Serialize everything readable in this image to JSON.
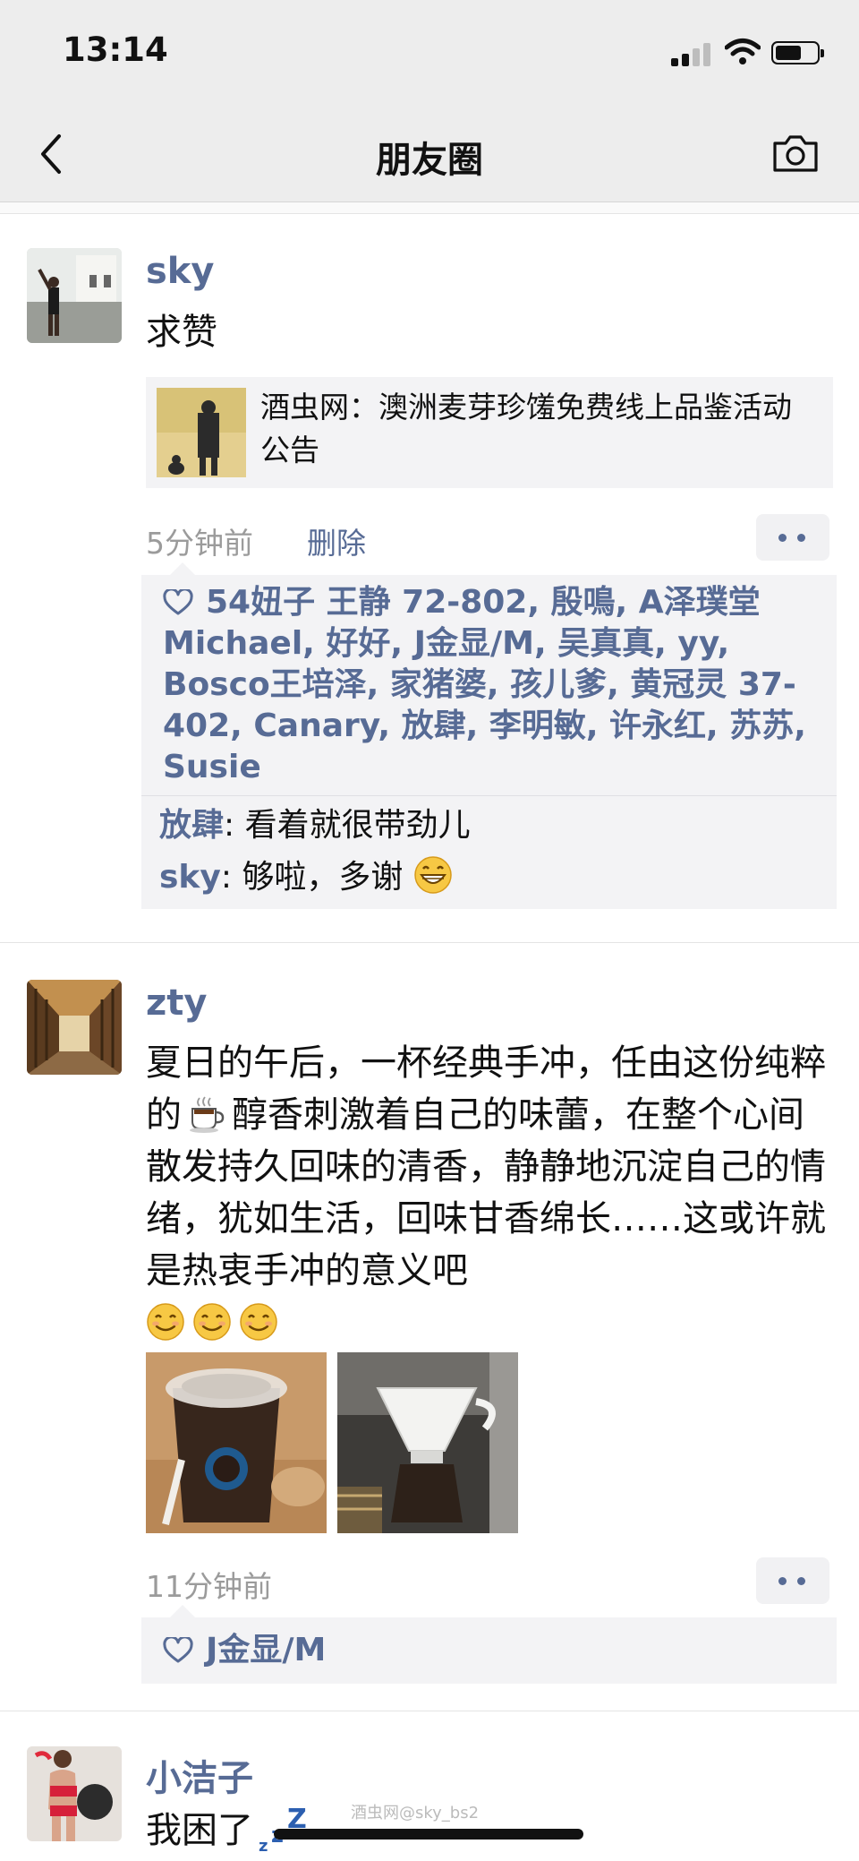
{
  "status": {
    "time": "13:14"
  },
  "nav": {
    "title": "朋友圈",
    "back_icon": "chevron-left-icon",
    "camera_icon": "camera-icon"
  },
  "posts": [
    {
      "user": "sky",
      "text": "求赞",
      "link": {
        "title": "酒虫网：澳洲麦芽珍馐免费线上品鉴活动公告"
      },
      "time": "5分钟前",
      "delete_label": "删除",
      "likes": "54妞子 王静 72-802, 殷鳴, A泽璞堂Michael, 好好, J金显/M, 吴真真, yy, Bosco王培泽, 家猪婆, 孩儿爹, 黄冠灵 37-402, Canary, 放肆, 李明敏, 许永红, 苏苏, Susie",
      "comments": [
        {
          "name": "放肆",
          "text": ": 看着就很带劲儿"
        },
        {
          "name": "sky",
          "text": ": 够啦，多谢"
        }
      ]
    },
    {
      "user": "zty",
      "text": "夏日的午后，一杯经典手冲，任由这份纯粹的",
      "text_2": "醇香刺激着自己的味蕾，在整个心间散发持久回味的清香，静静地沉淀自己的情绪，犹如生活，回味甘香绵长……这或许就是热衷手冲的意义吧",
      "time": "11分钟前",
      "likes": "J金显/M"
    },
    {
      "user": "小洁子",
      "text": "我困了"
    }
  ],
  "watermark": "酒虫网@sky_bs2",
  "colors": {
    "link_blue": "#576b95",
    "bar_gray": "#ededed",
    "box_gray": "#f3f3f5"
  }
}
